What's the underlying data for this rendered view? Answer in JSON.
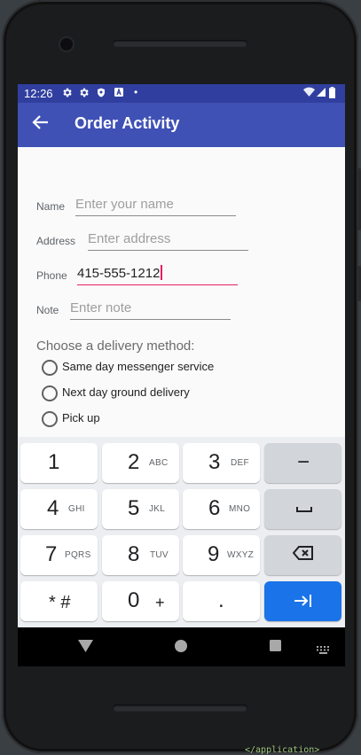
{
  "status_bar": {
    "time": "12:26",
    "icons": [
      "settings-icon",
      "settings-icon",
      "shield-icon",
      "a-notification-icon",
      "dot-icon",
      "wifi-icon",
      "signal-icon",
      "battery-icon"
    ]
  },
  "app_bar": {
    "title": "Order Activity",
    "back_icon": "arrow-back-icon"
  },
  "form": {
    "name": {
      "label": "Name",
      "value": "",
      "placeholder": "Enter your name"
    },
    "address": {
      "label": "Address",
      "value": "",
      "placeholder": "Enter address"
    },
    "phone": {
      "label": "Phone",
      "value": "415-555-1212",
      "placeholder": ""
    },
    "note": {
      "label": "Note",
      "value": "",
      "placeholder": "Enter note"
    }
  },
  "delivery": {
    "heading": "Choose a delivery method:",
    "options": [
      "Same day messenger service",
      "Next day ground delivery",
      "Pick up"
    ]
  },
  "keyboard": {
    "keys": [
      {
        "main": "1",
        "sub": ""
      },
      {
        "main": "2",
        "sub": "ABC"
      },
      {
        "main": "3",
        "sub": "DEF"
      },
      {
        "main": "−",
        "sub": ""
      },
      {
        "main": "4",
        "sub": "GHI"
      },
      {
        "main": "5",
        "sub": "JKL"
      },
      {
        "main": "6",
        "sub": "MNO"
      },
      {
        "main": "␣",
        "sub": ""
      },
      {
        "main": "7",
        "sub": "PQRS"
      },
      {
        "main": "8",
        "sub": "TUV"
      },
      {
        "main": "9",
        "sub": "WXYZ"
      },
      {
        "main": "⌫",
        "sub": ""
      },
      {
        "main": "* #",
        "sub": ""
      },
      {
        "main": "0",
        "sub": "+"
      },
      {
        "main": ".",
        "sub": ""
      },
      {
        "main": "⇥",
        "sub": ""
      }
    ]
  },
  "nav_bar": {
    "icons": [
      "back-triangle-icon",
      "home-circle-icon",
      "recents-square-icon",
      "keyboard-switch-icon"
    ]
  },
  "background_text": "</application>",
  "colors": {
    "primary": "#3f51b5",
    "primary_dark": "#303f9f",
    "accent": "#e91e63",
    "keyboard_action": "#1a73e8"
  }
}
